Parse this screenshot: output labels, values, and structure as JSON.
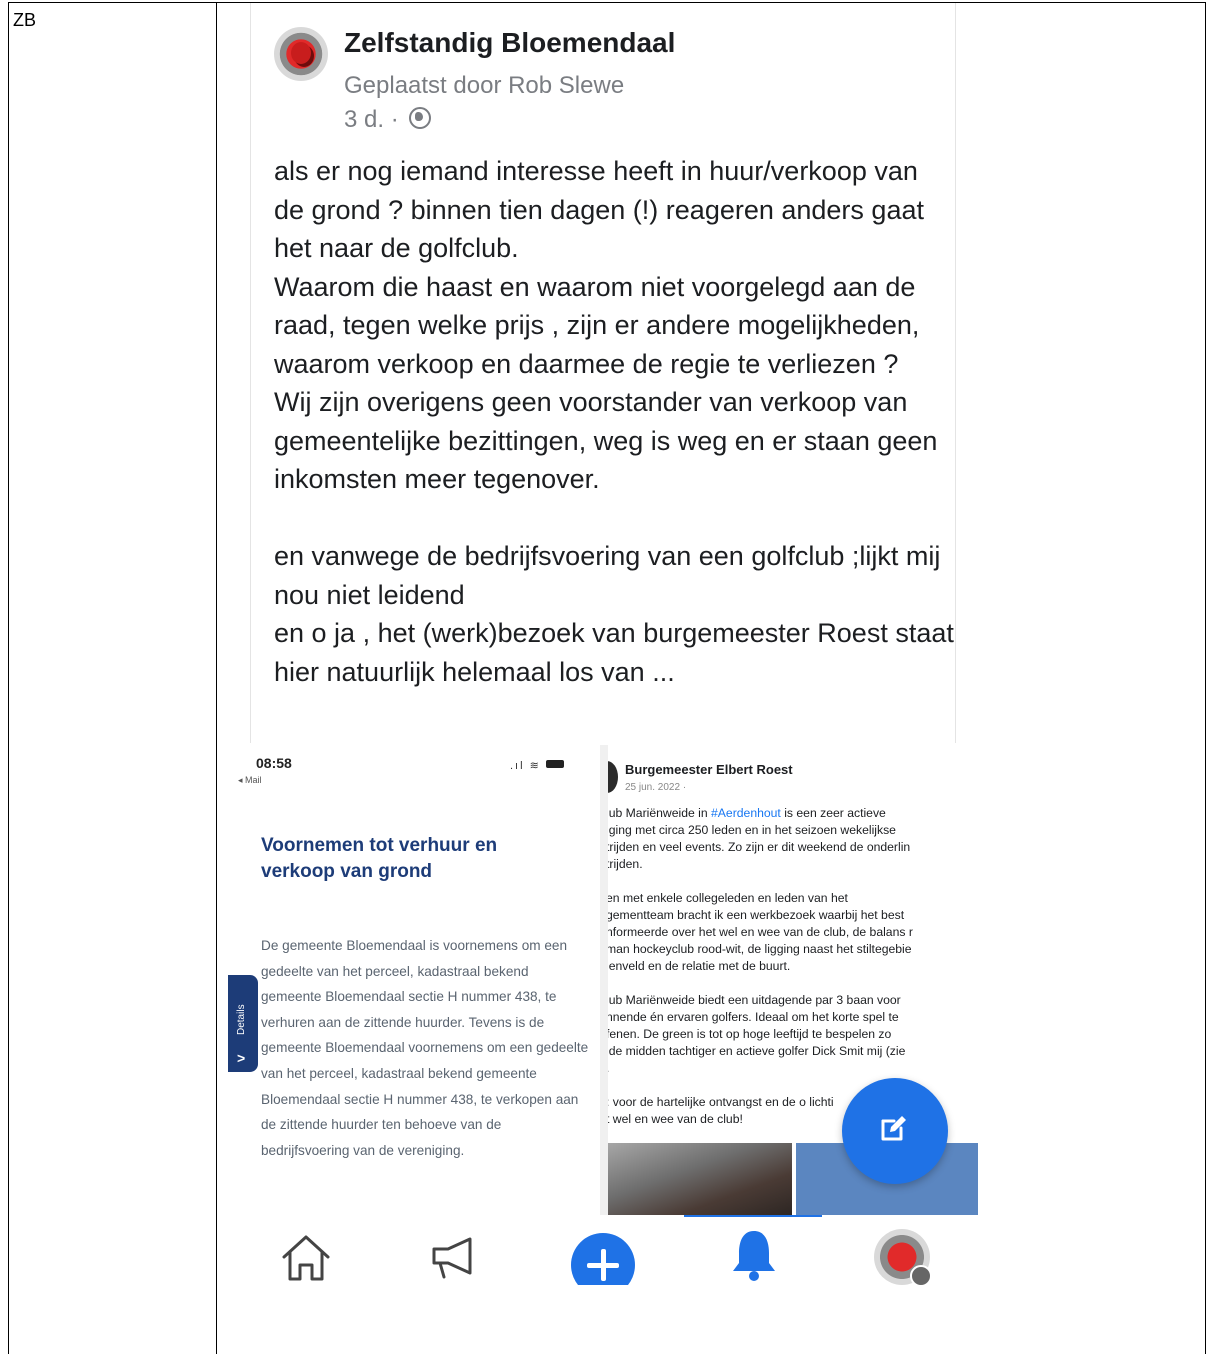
{
  "document": {
    "row_label": "ZB"
  },
  "post": {
    "page_name": "Zelfstandig Bloemendaal",
    "posted_by": "Geplaatst door Rob Slewe",
    "time": "3 d. ·",
    "paragraphs": [
      "als er nog iemand interesse heeft in huur/verkoop van de grond ? binnen tien dagen (!) reageren anders gaat het naar de golfclub.",
      "Waarom die haast en waarom niet voorgelegd aan de raad, tegen welke prijs , zijn er andere mogelijkheden, waarom verkoop en daarmee de regie te verliezen ?",
      "Wij zijn overigens geen voorstander van verkoop van gemeentelijke bezittingen, weg is weg en er staan geen inkomsten meer tegenover.",
      "en vanwege de bedrijfsvoering van een golfclub ;lijkt mij nou niet leidend",
      "en o ja , het (werk)bezoek van burgemeester Roest staat hier natuurlijk helemaal los van ..."
    ]
  },
  "embedded_notice": {
    "status_time": "08:58",
    "status_back": "◂ Mail",
    "title": "Voornemen tot verhuur en verkoop van grond",
    "body": "De gemeente Bloemendaal is voornemens om een gedeelte van het perceel, kadastraal bekend gemeente Bloemendaal sectie H nummer 438, te verhuren aan de zittende huurder. Tevens is de gemeente Bloemendaal voornemens om een gedeelte van het perceel, kadastraal bekend gemeente Bloemendaal sectie H nummer 438, te verkopen aan de zittende huurder ten behoeve van de bedrijfsvoering van de vereniging.",
    "details_tab": "Details"
  },
  "embedded_mayor_post": {
    "name": "Burgemeester Elbert Roest",
    "date": "25 jun. 2022 ·",
    "text_before_hashtag": "lub Mariënweide in ",
    "hashtag": "#Aerdenhout",
    "text_after_hashtag": " is een zeer actieve\niging met circa 250 leden en in het seizoen wekelijkse\ntrijden en veel events. Zo zijn er dit weekend de onderlin\ntrijden.\n\nen met enkele collegeleden en leden van het\ngementteam bracht ik een werkbezoek waarbij het best\nnformeerde over het wel en wee van de club, de balans r\nman hockeyclub rood-wit, de ligging naast het stiltegebie\nlenveld en de relatie met de buurt.\n\nlub Mariënweide biedt een uitdagende par 3 baan voor\nnnende én ervaren golfers. Ideaal om het korte spel te\nfenen. De green is tot op hoge leeftijd te bespelen zo\nlde midden tachtiger en actieve golfer Dick Smit mij (zie\n.\n\n: voor de hartelijke ontvangst en de o              lichti\nt wel en wee van de club!"
  },
  "icons": [
    "globe-icon",
    "battery-icon",
    "chevron-right-icon",
    "edit-icon",
    "home-icon",
    "megaphone-icon",
    "plus-icon",
    "bell-icon",
    "menu-badge"
  ],
  "colors": {
    "facebook_blue": "#1f72e6",
    "notice_title": "#1d3c78",
    "hashtag": "#1877f2"
  }
}
